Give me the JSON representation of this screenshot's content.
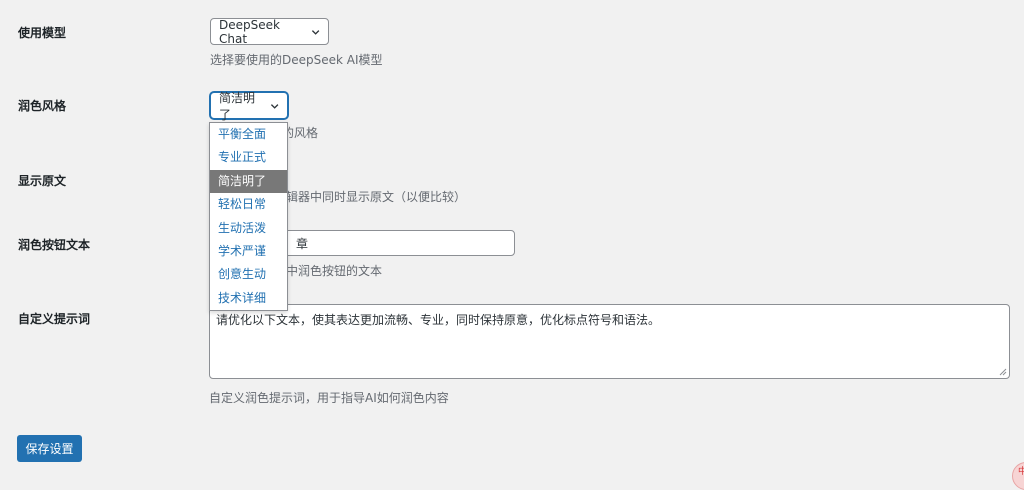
{
  "model": {
    "label": "使用模型",
    "selected": "DeepSeek Chat",
    "description": "选择要使用的DeepSeek AI模型"
  },
  "style": {
    "label": "润色风格",
    "selected": "简洁明了",
    "description_partial": "的风格",
    "options": [
      "平衡全面",
      "专业正式",
      "简洁明了",
      "轻松日常",
      "生动活泼",
      "学术严谨",
      "创意生动",
      "技术详细"
    ]
  },
  "show_original": {
    "label": "显示原文",
    "description_partial": "辑器中同时显示原文（以便比较）"
  },
  "button_text": {
    "label": "润色按钮文本",
    "value_partial": "章",
    "description_partial": "中润色按钮的文本"
  },
  "prompt": {
    "label": "自定义提示词",
    "value": "请优化以下文本，使其表达更加流畅、专业，同时保持原意，优化标点符号和语法。",
    "description": "自定义润色提示词，用于指导AI如何润色内容"
  },
  "save_label": "保存设置",
  "corner_badge": "中",
  "colors": {
    "accent": "#2271b1",
    "background": "#f1f1f1",
    "selected_option": "#787878"
  }
}
